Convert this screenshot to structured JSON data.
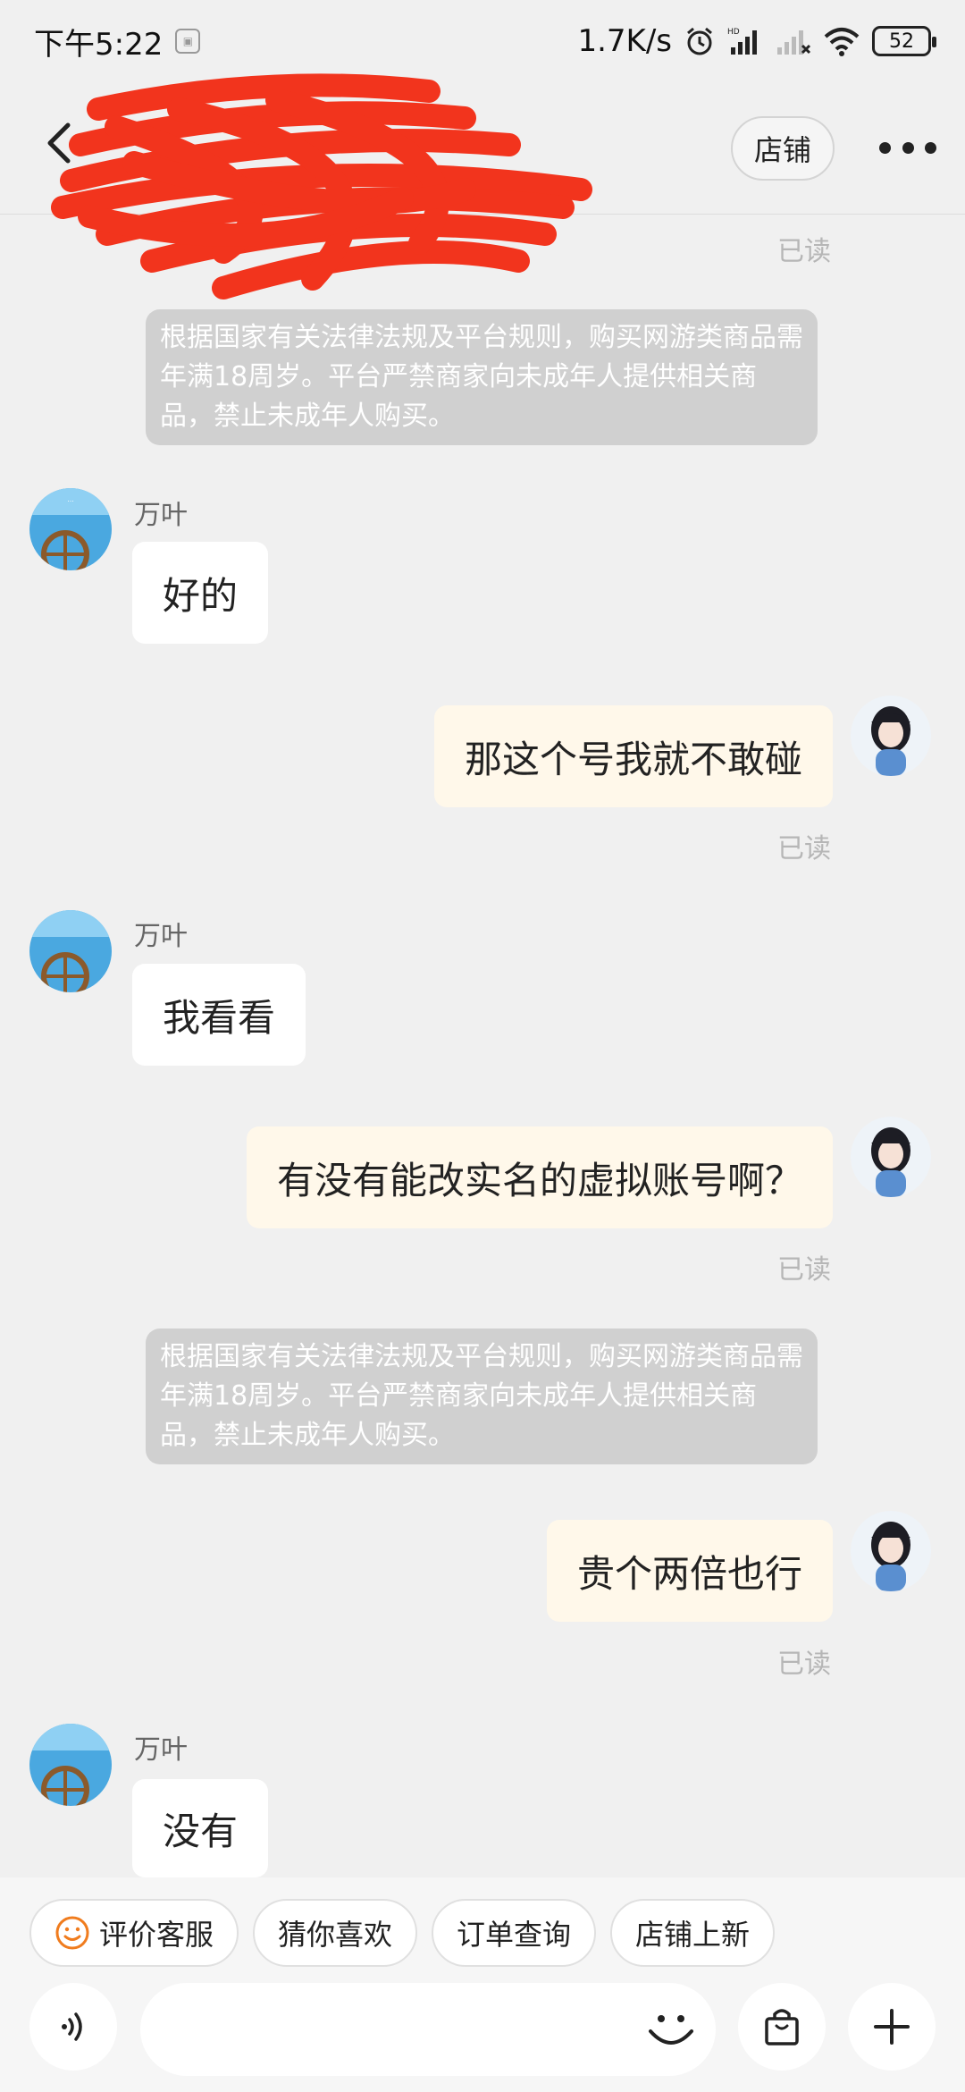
{
  "status_bar": {
    "time": "下午5:22",
    "network_speed": "1.7K/s",
    "battery": "52",
    "icons": [
      "notification-icon",
      "alarm-icon",
      "hd-signal-icon",
      "signal-icon",
      "wifi-icon",
      "battery-icon"
    ]
  },
  "header": {
    "shop_label": "店铺",
    "title_redacted": true
  },
  "messages": {
    "read_1": "已读",
    "notice_1": "根据国家有关法律法规及平台规则，购买网游类商品需年满18周岁。平台严禁商家向未成年人提供相关商品，禁止未成年人购买。",
    "msg_1_sender": "万叶",
    "msg_1_text": "好的",
    "msg_2_text": "那这个号我就不敢碰",
    "read_2": "已读",
    "msg_3_sender": "万叶",
    "msg_3_text": "我看看",
    "msg_4_text": "有没有能改实名的虚拟账号啊？",
    "read_3": "已读",
    "notice_2": "根据国家有关法律法规及平台规则，购买网游类商品需年满18周岁。平台严禁商家向未成年人提供相关商品，禁止未成年人购买。",
    "msg_5_text": "贵个两倍也行",
    "read_4": "已读",
    "msg_6_sender": "万叶",
    "msg_6_text": "没有"
  },
  "quick_actions": {
    "chip_1": "评价客服",
    "chip_2": "猜你喜欢",
    "chip_3": "订单查询",
    "chip_4": "店铺上新"
  },
  "input": {
    "placeholder": ""
  },
  "colors": {
    "background": "#f0f0f0",
    "my_bubble": "#fff8ea",
    "other_bubble": "#ffffff",
    "notice_bg": "#d0d0d0",
    "redaction": "#f2341d",
    "accent_orange": "#f07c1e"
  }
}
